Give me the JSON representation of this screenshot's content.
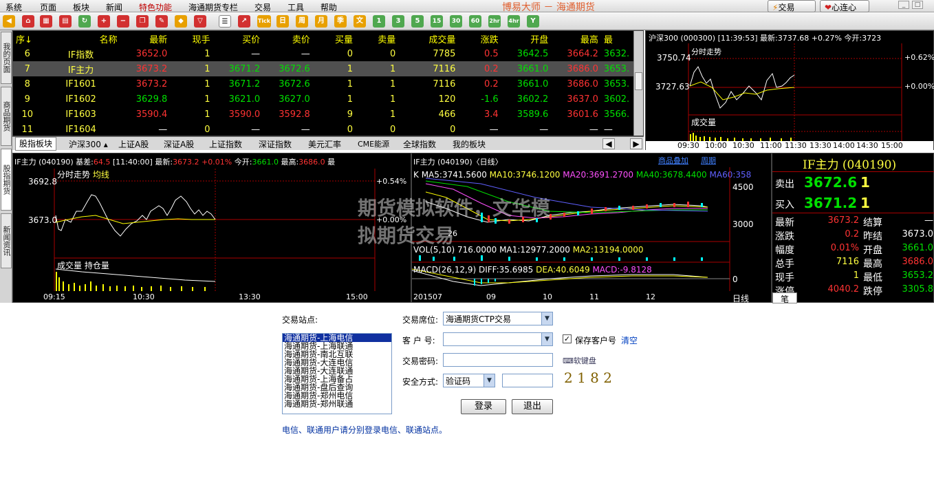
{
  "menu": [
    "系统",
    "页面",
    "板块",
    "新闻",
    "特色功能",
    "海通期货专栏",
    "交易",
    "工具",
    "帮助"
  ],
  "app_title": "博易大师 － 海通期货",
  "top_buttons": {
    "trade": "交易",
    "heart": "心连心"
  },
  "toolbar": [
    "Tick",
    "日",
    "周",
    "月",
    "季",
    "文",
    "1",
    "3",
    "5",
    "15",
    "30",
    "60",
    "2hr",
    "4hr",
    "Y"
  ],
  "side_tabs": [
    "我的页面",
    "商品期货",
    "股指期货",
    "新闻资讯"
  ],
  "quote": {
    "headers": [
      "序↓",
      "名称",
      "最新",
      "现手",
      "买价",
      "卖价",
      "买量",
      "卖量",
      "成交量",
      "涨跌",
      "开盘",
      "最高",
      "最"
    ],
    "rows": [
      [
        "6",
        "IF指数",
        "3652.0",
        "1",
        "—",
        "—",
        "0",
        "0",
        "7785",
        "0.5",
        "3642.5",
        "3664.2",
        "3632."
      ],
      [
        "7",
        "IF主力",
        "3673.2",
        "1",
        "3671.2",
        "3672.6",
        "1",
        "1",
        "7116",
        "0.2",
        "3661.0",
        "3686.0",
        "3653."
      ],
      [
        "8",
        "IF1601",
        "3673.2",
        "1",
        "3671.2",
        "3672.6",
        "1",
        "1",
        "7116",
        "0.2",
        "3661.0",
        "3686.0",
        "3653."
      ],
      [
        "9",
        "IF1602",
        "3629.8",
        "1",
        "3621.0",
        "3627.0",
        "1",
        "1",
        "120",
        "-1.6",
        "3602.2",
        "3637.0",
        "3602."
      ],
      [
        "10",
        "IF1603",
        "3590.4",
        "1",
        "3590.0",
        "3592.8",
        "9",
        "1",
        "466",
        "3.4",
        "3589.6",
        "3601.6",
        "3566."
      ],
      [
        "11",
        "IF1604",
        "—",
        "0",
        "—",
        "—",
        "0",
        "0",
        "0",
        "—",
        "—",
        "—",
        "—"
      ]
    ],
    "tabs": [
      "股指板块",
      "沪深300 ▴",
      "上证A股",
      "深证A股",
      "上证指数",
      "深证指数",
      "美元汇率",
      "CME能源",
      "全球指数",
      "我的板块"
    ]
  },
  "hs300": {
    "header": "沪深300 (000300)  [11:39:53]  最新:3737.68  +0.27%  今开:3723",
    "title": "分时走势",
    "hi": "3750.74",
    "mid": "3727.63",
    "pct_hi": "+0.62%",
    "pct_mid": "+0.00%",
    "vol": "成交量",
    "times": [
      "09:30",
      "10:00",
      "10:30",
      "11:00",
      "11:30",
      "13:30",
      "14:00",
      "14:30",
      "15:00"
    ]
  },
  "if_intraday": {
    "h1": "IF主力 (040190)  基差:",
    "basis": "64.5",
    "h2": "[11:40:00]  最新:",
    "last": "3673.2",
    "pct": "+0.01%",
    "h3": "今开:",
    "open": "3661.0",
    "h4": "最高:",
    "high": "3686.0",
    "h5": "最",
    "title": "分时走势",
    "avg": "均线",
    "hi": "3692.8",
    "mid": "3673.0",
    "pct_hi": "+0.54%",
    "pct_mid": "+0.00%",
    "vol": "成交量",
    "oi": "持仓量",
    "times": [
      "09:15",
      "10:30",
      "13:30",
      "15:00"
    ]
  },
  "kline": {
    "header": "IF主力 (040190)〈日线〉",
    "overlay": "商品叠加",
    "period": "周期",
    "ma": [
      "K",
      "MA5:3741.5600",
      "MA10:3746.1200",
      "MA20:3691.2700",
      "MA40:3678.4400",
      "MA60:358"
    ],
    "y1": "4500",
    "y2": "3000",
    "label26": "26",
    "vol": "VOL(5,10) 716.0000",
    "vma1": "MA1:12977.2000",
    "vma2": "MA2:13194.0000",
    "macd": "MACD(26,12,9)",
    "diff": "DIFF:35.6985",
    "dea": "DEA:40.6049",
    "macdv": "MACD:-9.8128",
    "zero": "0",
    "dates": [
      "201507",
      "09",
      "10",
      "11",
      "12"
    ],
    "daily": "日线"
  },
  "info": {
    "title": "IF主力 (040190)",
    "sell_label": "卖出",
    "sell": "3672.6",
    "sell_qty": "1",
    "buy_label": "买入",
    "buy": "3671.2",
    "buy_qty": "1",
    "rows": [
      [
        "最新",
        "3673.2",
        "结算",
        "—"
      ],
      [
        "涨跌",
        "0.2",
        "昨结",
        "3673.0"
      ],
      [
        "幅度",
        "0.01%",
        "开盘",
        "3661.0"
      ],
      [
        "总手",
        "7116",
        "最高",
        "3686.0"
      ],
      [
        "现手",
        "1",
        "最低",
        "3653.2"
      ],
      [
        "涨停",
        "4040.2",
        "跌停",
        "3305.8"
      ]
    ],
    "tab": "笔"
  },
  "watermark": [
    "期货模拟软件，文华模",
    "拟期货交易"
  ],
  "login": {
    "station_label": "交易站点:",
    "stations": [
      "海通期货-上海电信",
      "海通期货-上海联通",
      "海通期货-南北互联",
      "海通期货-大连电信",
      "海通期货-大连联通",
      "海通期货-上海备占",
      "海通期货-盘后查询",
      "海通期货-郑州电信",
      "海通期货-郑州联通"
    ],
    "seat_label": "交易席位:",
    "seat_value": "海通期货CTP交易",
    "account_label": "客 户 号:",
    "account_value": "",
    "save_label": "保存客户号",
    "clear": "清空",
    "pwd_label": "交易密码:",
    "keyboard": "软键盘",
    "sec_label": "安全方式:",
    "sec_value": "验证码",
    "captcha": "2 1 8 2",
    "login_btn": "登录",
    "exit_btn": "退出",
    "note": "电信、联通用户请分别登录电信、联通站点。"
  }
}
